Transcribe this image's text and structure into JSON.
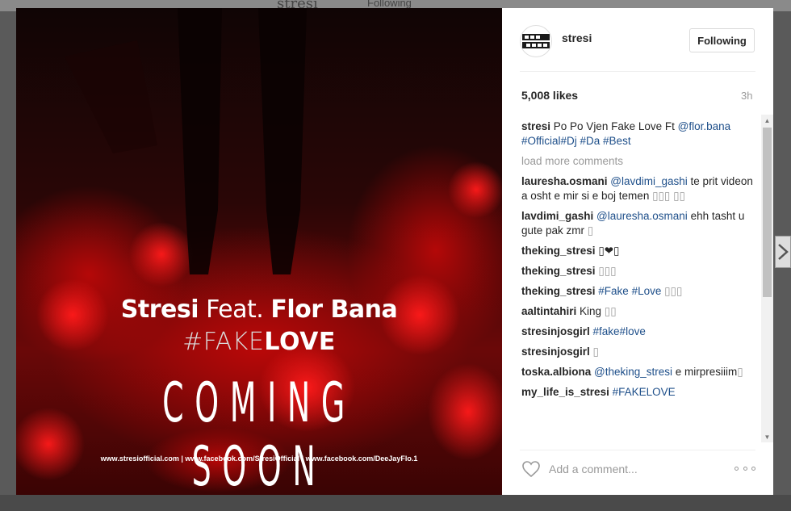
{
  "background": {
    "top_title": "stresi",
    "top_following": "Following"
  },
  "media": {
    "artist": "Stresi",
    "feat": " Feat. ",
    "featured": "Flor Bana",
    "tag_prefix": "#FAKE",
    "tag_suffix": "LOVE",
    "coming_soon": "COMING SOON",
    "links": "www.stresiofficial.com  |  www.facebook.com/StresiOfficial  |  www.facebook.com/DeeJayFlo.1"
  },
  "header": {
    "username": "stresi",
    "follow_label": "Following",
    "avatar_icon": "bad-boys-logo-icon"
  },
  "post": {
    "likes": "5,008 likes",
    "time": "3h"
  },
  "caption": {
    "user": "stresi",
    "text": " Po Po Vjen Fake Love Ft ",
    "mentions": "@flor.bana #Official#Dj #Da #Best"
  },
  "load_more": "load more comments",
  "comments": [
    {
      "user": "lauresha.osmani",
      "mention": " @lavdimi_gashi",
      "text": " te prit videon a osht e mir si e boj temen ",
      "emoji": "▯▯▯ ▯▯"
    },
    {
      "user": "lavdimi_gashi",
      "mention": " @lauresha.osmani",
      "text": " ehh tasht u gute pak zmr ",
      "emoji": "▯"
    },
    {
      "user": "theking_stresi",
      "mention": "",
      "text": " ",
      "emoji": "▯❤▯"
    },
    {
      "user": "theking_stresi",
      "mention": "",
      "text": " ",
      "emoji": "▯▯▯"
    },
    {
      "user": "theking_stresi",
      "mention": " #Fake #Love",
      "text": " ",
      "emoji": "▯▯▯"
    },
    {
      "user": "aaltintahiri",
      "mention": "",
      "text": " King ",
      "emoji": "▯▯"
    },
    {
      "user": "stresinjosgirl",
      "mention": " #fake#love",
      "text": "",
      "emoji": ""
    },
    {
      "user": "stresinjosgirl",
      "mention": "",
      "text": " ",
      "emoji": "▯"
    },
    {
      "user": "toska.albiona",
      "mention": " @theking_stresi",
      "text": " e mirpresiiim",
      "emoji": "▯"
    },
    {
      "user": "my_life_is_stresi",
      "mention": " #FAKELOVE",
      "text": "",
      "emoji": ""
    }
  ],
  "comment_bar": {
    "placeholder": "Add a comment...",
    "like_icon": "heart-icon",
    "more_icon": "more-options-icon"
  },
  "colors": {
    "accent_link": "#1e4f8a",
    "muted": "#999999",
    "text": "#262626"
  }
}
